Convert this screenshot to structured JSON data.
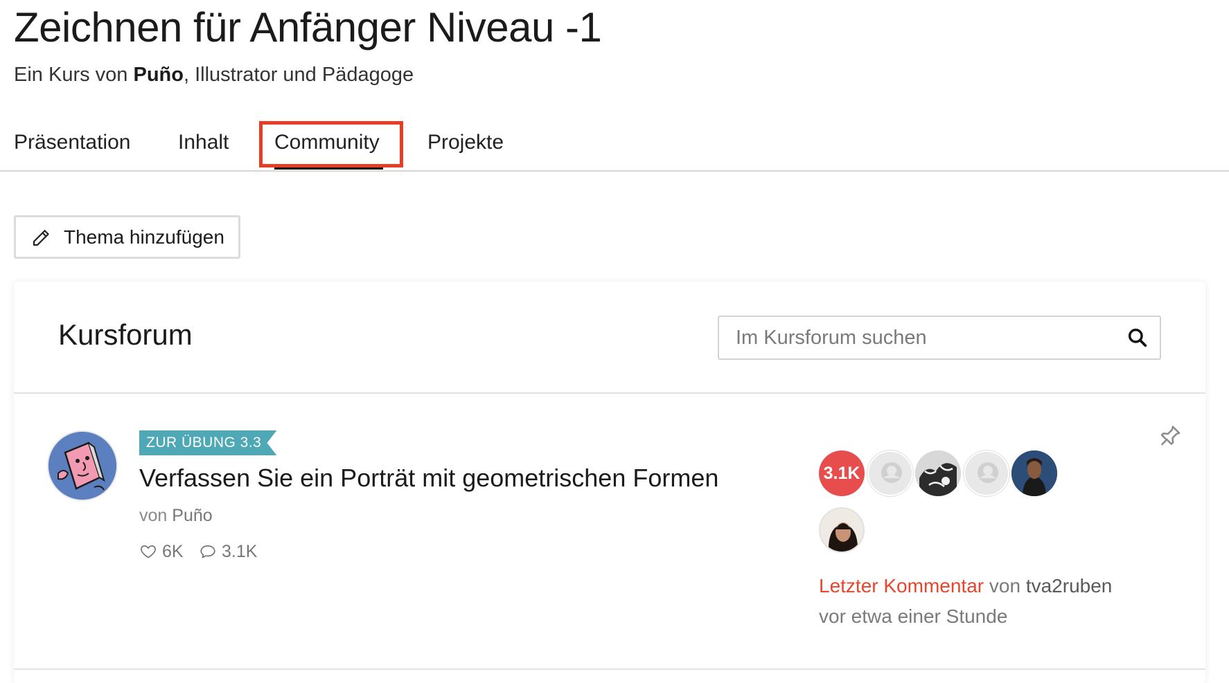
{
  "course": {
    "title": "Zeichnen für Anfänger Niveau -1",
    "subtitle_prefix": "Ein Kurs von",
    "author": "Puño",
    "subtitle_suffix": ", Illustrator und Pädagoge"
  },
  "tabs": [
    {
      "label": "Präsentation",
      "active": false
    },
    {
      "label": "Inhalt",
      "active": false
    },
    {
      "label": "Community",
      "active": true
    },
    {
      "label": "Projekte",
      "active": false
    }
  ],
  "actions": {
    "add_topic_label": "Thema hinzufügen",
    "add_topic_icon": "pencil-icon"
  },
  "forum": {
    "title": "Kursforum",
    "search_placeholder": "Im Kursforum suchen",
    "search_icon": "search-icon"
  },
  "post": {
    "tag": "ZUR ÜBUNG 3.3",
    "title": "Verfassen Sie ein Porträt mit geometrischen Formen",
    "author_prefix": "von",
    "author": "Puño",
    "likes": "6K",
    "comments": "3.1K",
    "participants_count": "3.1K",
    "last_comment_label": "Letzter Kommentar",
    "last_comment_by_prefix": "von",
    "last_comment_user": "tva2ruben",
    "last_comment_time": "vor etwa einer Stunde"
  },
  "colors": {
    "accent_red": "#e8452c",
    "tag_teal": "#4ea8b5",
    "count_badge": "#e84d4d",
    "highlight_box": "#e63d24"
  }
}
